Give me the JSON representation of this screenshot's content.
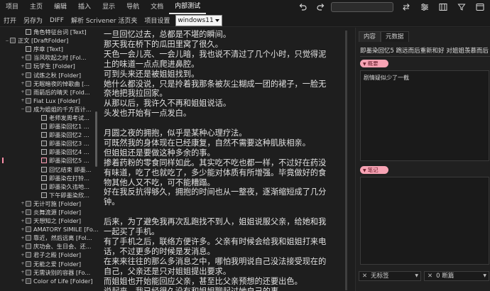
{
  "menu": {
    "items": [
      "项目",
      "主页",
      "编辑",
      "插入",
      "显示",
      "导航",
      "文档",
      "内部测试"
    ],
    "active": "内部测试"
  },
  "toolbar": {
    "items": [
      "打开",
      "另存为",
      "DIFF",
      "解析 Scrivener 活页夹",
      "项目设置"
    ],
    "select_value": "windows11"
  },
  "binder": {
    "items": [
      {
        "label": "角色特征台词 [Text]",
        "indent": 1,
        "type": "doc",
        "expander": ""
      },
      {
        "label": "正文 [DraftFolder]",
        "indent": 0,
        "type": "folder",
        "expander": "−"
      },
      {
        "label": "序章 [Text]",
        "indent": 1,
        "type": "doc",
        "expander": ""
      },
      {
        "label": "当风吹起之时 [Fol...",
        "indent": 1,
        "type": "folder",
        "expander": "+"
      },
      {
        "label": "玩学生 [Folder]",
        "indent": 1,
        "type": "folder",
        "expander": "+"
      },
      {
        "label": "试炼之秋 [Folder]",
        "indent": 1,
        "type": "folder",
        "expander": "+"
      },
      {
        "label": "无眠暗夜的悼歌曲 [...",
        "indent": 1,
        "type": "folder",
        "expander": "+"
      },
      {
        "label": "雨箭后的晴天 [Fold...",
        "indent": 1,
        "type": "folder",
        "expander": "+"
      },
      {
        "label": "Fiat Lux [Folder]",
        "indent": 1,
        "type": "folder",
        "expander": "+"
      },
      {
        "label": "成为姐姐的千方百计...",
        "indent": 1,
        "type": "folder",
        "expander": "−"
      },
      {
        "label": "老师发周考试...",
        "indent": 2,
        "type": "doc",
        "expander": ""
      },
      {
        "label": "即墨染回忆1 ...",
        "indent": 2,
        "type": "doc",
        "expander": ""
      },
      {
        "label": "即墨染回忆2 ...",
        "indent": 2,
        "type": "doc",
        "expander": ""
      },
      {
        "label": "即墨染回忆3 ...",
        "indent": 2,
        "type": "doc",
        "expander": ""
      },
      {
        "label": "即墨染回忆4 ...",
        "indent": 2,
        "type": "doc",
        "expander": ""
      },
      {
        "label": "即墨染回忆5 ...",
        "indent": 2,
        "type": "doc",
        "expander": "",
        "selected": true
      },
      {
        "label": "回忆结束 即墨...",
        "indent": 2,
        "type": "doc",
        "expander": ""
      },
      {
        "label": "即墨染在打铃...",
        "indent": 2,
        "type": "doc",
        "expander": ""
      },
      {
        "label": "即墨染久违地...",
        "indent": 2,
        "type": "doc",
        "expander": ""
      },
      {
        "label": "下午即墨染欣...",
        "indent": 2,
        "type": "doc",
        "expander": ""
      },
      {
        "label": "无计可施 [Folder]",
        "indent": 1,
        "type": "folder",
        "expander": "+"
      },
      {
        "label": "炎舞流源 [Folder]",
        "indent": 1,
        "type": "folder",
        "expander": "+"
      },
      {
        "label": "天想知之 [Folder]",
        "indent": 1,
        "type": "folder",
        "expander": "+"
      },
      {
        "label": "AMATORY SIMILE [Fo...",
        "indent": 1,
        "type": "folder",
        "expander": "+"
      },
      {
        "label": "靠近，然后远离 [Fol...",
        "indent": 1,
        "type": "folder",
        "expander": "+"
      },
      {
        "label": "庆功会、生日会、还...",
        "indent": 1,
        "type": "folder",
        "expander": "+"
      },
      {
        "label": "君子之殿 [Folder]",
        "indent": 1,
        "type": "folder",
        "expander": "+"
      },
      {
        "label": "无能之爱 [Folder]",
        "indent": 1,
        "type": "folder",
        "expander": "+"
      },
      {
        "label": "无需诀别的容器 [Fo...",
        "indent": 1,
        "type": "folder",
        "expander": "+"
      },
      {
        "label": "Color of Life [Folder]",
        "indent": 1,
        "type": "folder",
        "expander": "+"
      }
    ]
  },
  "editor": {
    "lines": [
      "一旦回忆过去，总都是不堪的瞬间。",
      "那天我在桥下的瓜田里窝了很久。",
      "天色一会儿亮、一会儿暗，我也说不清过了几个小时，只觉得泥",
      "土的味道一点点爬进鼻腔。",
      "可到头来还是被姐姐找到。",
      "她什么都没说，只是拎着我那条被灰尘糊成一团的裙子，一脸无",
      "奈地把我拉回家。",
      "从那以后，我许久不再和姐姐说话。",
      "头发也开始有一点发白。",
      "",
      "月圆之夜的拥抱，似乎是某种心理疗法。",
      "可既然我的身体现在已经康复，自然不需要这种肌肤相亲。",
      "但姐姐还是要做这种多余的事。",
      "掺着药粉的零食同样如此。其实吃不吃也都一样，不过好在药没",
      "有味道，吃了也就吃了，多少能对体质有所增强。毕竟做好的食",
      "物其他人又不吃，可不能糟蹋。",
      "好在我反抗得够久，拥抱的时间也从一整夜，逐渐缩短成了几分",
      "钟。",
      "",
      "后来，为了避免我再次乱跑找不到人，姐姐说服父亲，给她和我",
      "一起买了手机。",
      "有了手机之后，联络方便许多。父亲有时候会给我和姐姐打来电",
      "话，不过更多的时候是发消息。",
      "在来来往往的那么多消息之中，哪怕我明说自己没法接受现在的",
      "自己，父亲还是只对姐姐提出要求。",
      "而姐姐也开始能回应父亲，甚至比父亲预想的还要出色。",
      "说起来，我已经很久没有和姐姐聊起过她自己的事。"
    ]
  },
  "inspector": {
    "tabs": [
      "内容",
      "元数据"
    ],
    "active_tab": "内容",
    "title": "即墨染回忆5 跑远而后重新和好 对姐姐羡慕而后",
    "synopsis_label": "概要",
    "synopsis_text": "剧情疑似少了一截",
    "notes_label": "笔记",
    "notes_text": "",
    "label_field": "无标签",
    "status_field": "0 断篇"
  }
}
